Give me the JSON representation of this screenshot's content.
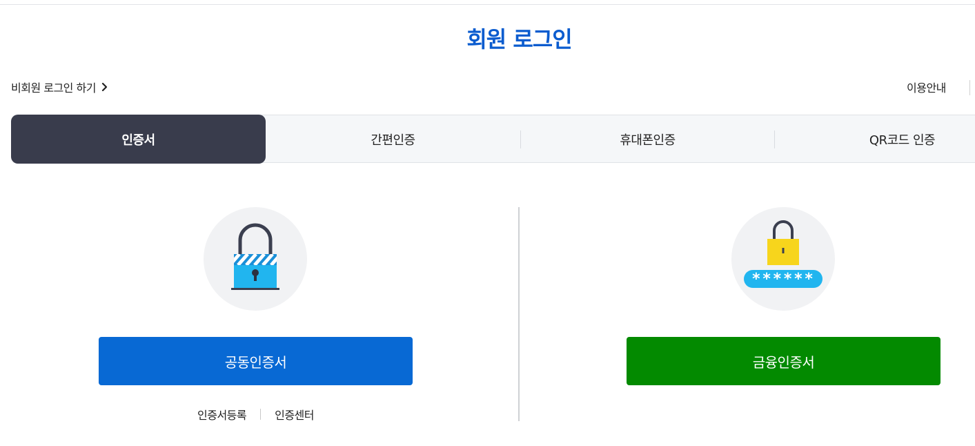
{
  "page": {
    "title": "회원 로그인",
    "guest_login_label": "비회원 로그인 하기",
    "usage_guide_label": "이용안내"
  },
  "tabs": [
    {
      "label": "인증서",
      "active": true
    },
    {
      "label": "간편인증",
      "active": false
    },
    {
      "label": "휴대폰인증",
      "active": false
    },
    {
      "label": "QR코드 인증",
      "active": false
    }
  ],
  "left_panel": {
    "icon": "certificate-lock-icon",
    "button_label": "공동인증서",
    "button_color": "#0869d4",
    "links": [
      {
        "label": "인증서등록"
      },
      {
        "label": "인증센터"
      }
    ]
  },
  "right_panel": {
    "icon": "financial-certificate-lock-icon",
    "button_label": "금융인증서",
    "button_color": "#038a00",
    "password_mask": "******"
  },
  "colors": {
    "title": "#0b5ccf",
    "active_tab": "#393c4c",
    "tab_bar": "#f5f7f9"
  }
}
